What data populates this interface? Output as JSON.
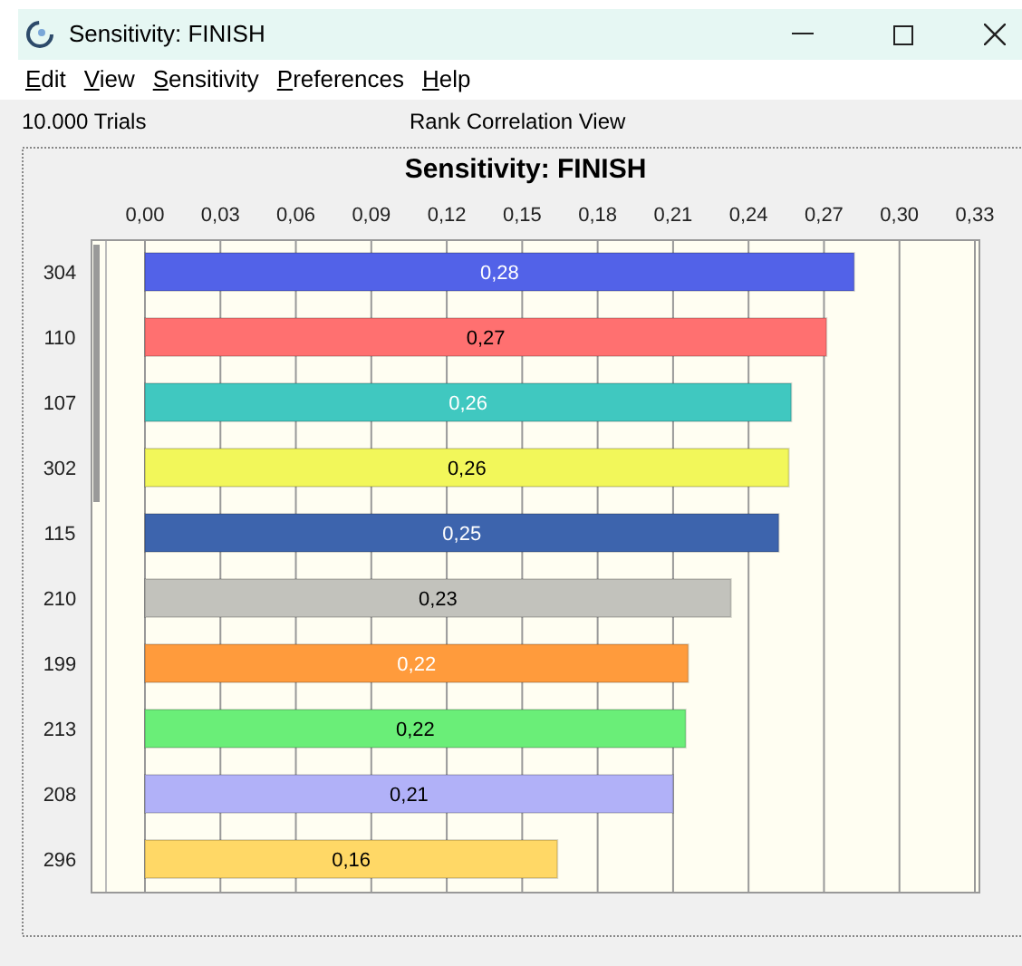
{
  "window": {
    "title": "Sensitivity: FINISH"
  },
  "menu": [
    {
      "label": "Edit"
    },
    {
      "label": "View"
    },
    {
      "label": "Sensitivity"
    },
    {
      "label": "Preferences"
    },
    {
      "label": "Help"
    }
  ],
  "info": {
    "trials": "10.000 Trials",
    "view": "Rank Correlation View"
  },
  "chart_data": {
    "type": "bar",
    "orientation": "horizontal",
    "grid": true,
    "title": "Sensitivity: FINISH",
    "categories": [
      "304",
      "110",
      "107",
      "302",
      "115",
      "210",
      "199",
      "213",
      "208",
      "296"
    ],
    "series": [
      {
        "color": "#5262e8",
        "values": [
          0.282,
          null,
          null,
          null,
          null,
          null,
          null,
          null,
          null,
          null
        ]
      },
      {
        "color": "#ff7070",
        "values": [
          null,
          0.271,
          null,
          null,
          null,
          null,
          null,
          null,
          null,
          null
        ]
      },
      {
        "color": "#40c8c0",
        "values": [
          null,
          null,
          0.257,
          null,
          null,
          null,
          null,
          null,
          null,
          null
        ]
      },
      {
        "color": "#f2f75a",
        "values": [
          null,
          null,
          null,
          0.256,
          null,
          null,
          null,
          null,
          null,
          null
        ]
      },
      {
        "color": "#3d64ad",
        "values": [
          null,
          null,
          null,
          null,
          0.252,
          null,
          null,
          null,
          null,
          null
        ]
      },
      {
        "color": "#c2c2bc",
        "values": [
          null,
          null,
          null,
          null,
          null,
          0.233,
          null,
          null,
          null,
          null
        ]
      },
      {
        "color": "#ff9b3c",
        "values": [
          null,
          null,
          null,
          null,
          null,
          null,
          0.216,
          null,
          null,
          null
        ]
      },
      {
        "color": "#6aee78",
        "values": [
          null,
          null,
          null,
          null,
          null,
          null,
          null,
          0.215,
          null,
          null
        ]
      },
      {
        "color": "#b1b1f8",
        "values": [
          null,
          null,
          null,
          null,
          null,
          null,
          null,
          null,
          0.21,
          null
        ]
      },
      {
        "color": "#ffd866",
        "values": [
          null,
          null,
          null,
          null,
          null,
          null,
          null,
          null,
          null,
          0.164
        ]
      }
    ],
    "value_labels": [
      "0,28",
      "0,27",
      "0,26",
      "0,26",
      "0,25",
      "0,23",
      "0,22",
      "0,22",
      "0,21",
      "0,16"
    ],
    "xlim": [
      0,
      0.33
    ],
    "xticks": [
      {
        "value": 0,
        "label": "0,00"
      },
      {
        "value": 0.03,
        "label": "0,03"
      },
      {
        "value": 0.06,
        "label": "0,06"
      },
      {
        "value": 0.09,
        "label": "0,09"
      },
      {
        "value": 0.12,
        "label": "0,12"
      },
      {
        "value": 0.15,
        "label": "0,15"
      },
      {
        "value": 0.18,
        "label": "0,18"
      },
      {
        "value": 0.21,
        "label": "0,21"
      },
      {
        "value": 0.24,
        "label": "0,24"
      },
      {
        "value": 0.27,
        "label": "0,27"
      },
      {
        "value": 0.3,
        "label": "0,30"
      },
      {
        "value": 0.33,
        "label": "0,33"
      }
    ]
  }
}
